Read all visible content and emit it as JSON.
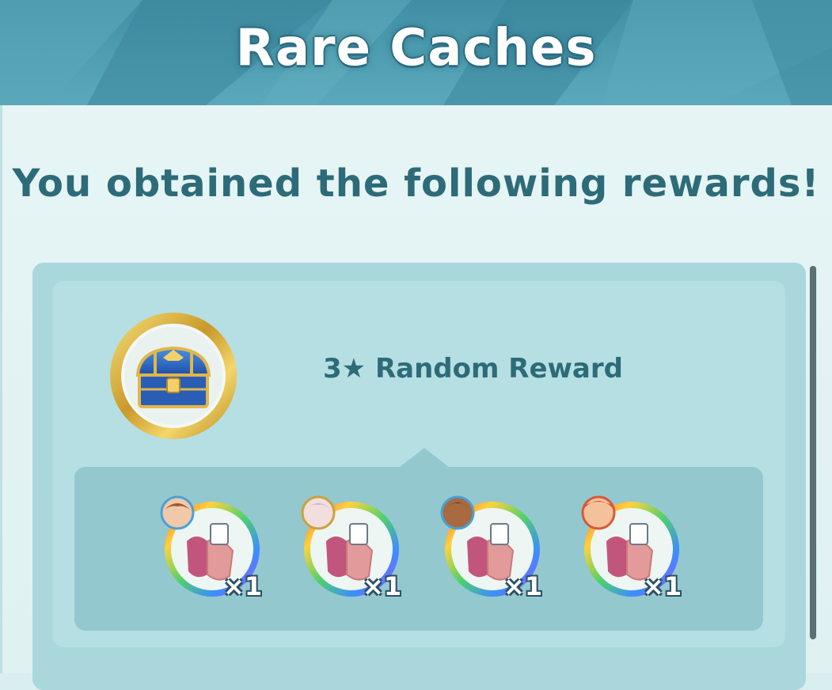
{
  "header": {
    "title": "Rare Caches"
  },
  "message": "You obtained the following rewards!",
  "reward": {
    "icon": "treasure-chest-icon",
    "label": "3★ Random Reward"
  },
  "items": [
    {
      "icon": "move-candy-icon",
      "portrait": "trainer-portrait-brown-hair",
      "quantity": "×1"
    },
    {
      "icon": "move-candy-icon",
      "portrait": "trainer-portrait-silver-hair",
      "quantity": "×1"
    },
    {
      "icon": "move-candy-icon",
      "portrait": "trainer-portrait-dark-hair",
      "quantity": "×1"
    },
    {
      "icon": "move-candy-icon",
      "portrait": "trainer-portrait-red-hat",
      "quantity": "×1"
    }
  ],
  "colors": {
    "header": "#4a97ab",
    "text": "#2d6b78",
    "panel": "#a9d7dc",
    "tray": "#93c8cf"
  }
}
